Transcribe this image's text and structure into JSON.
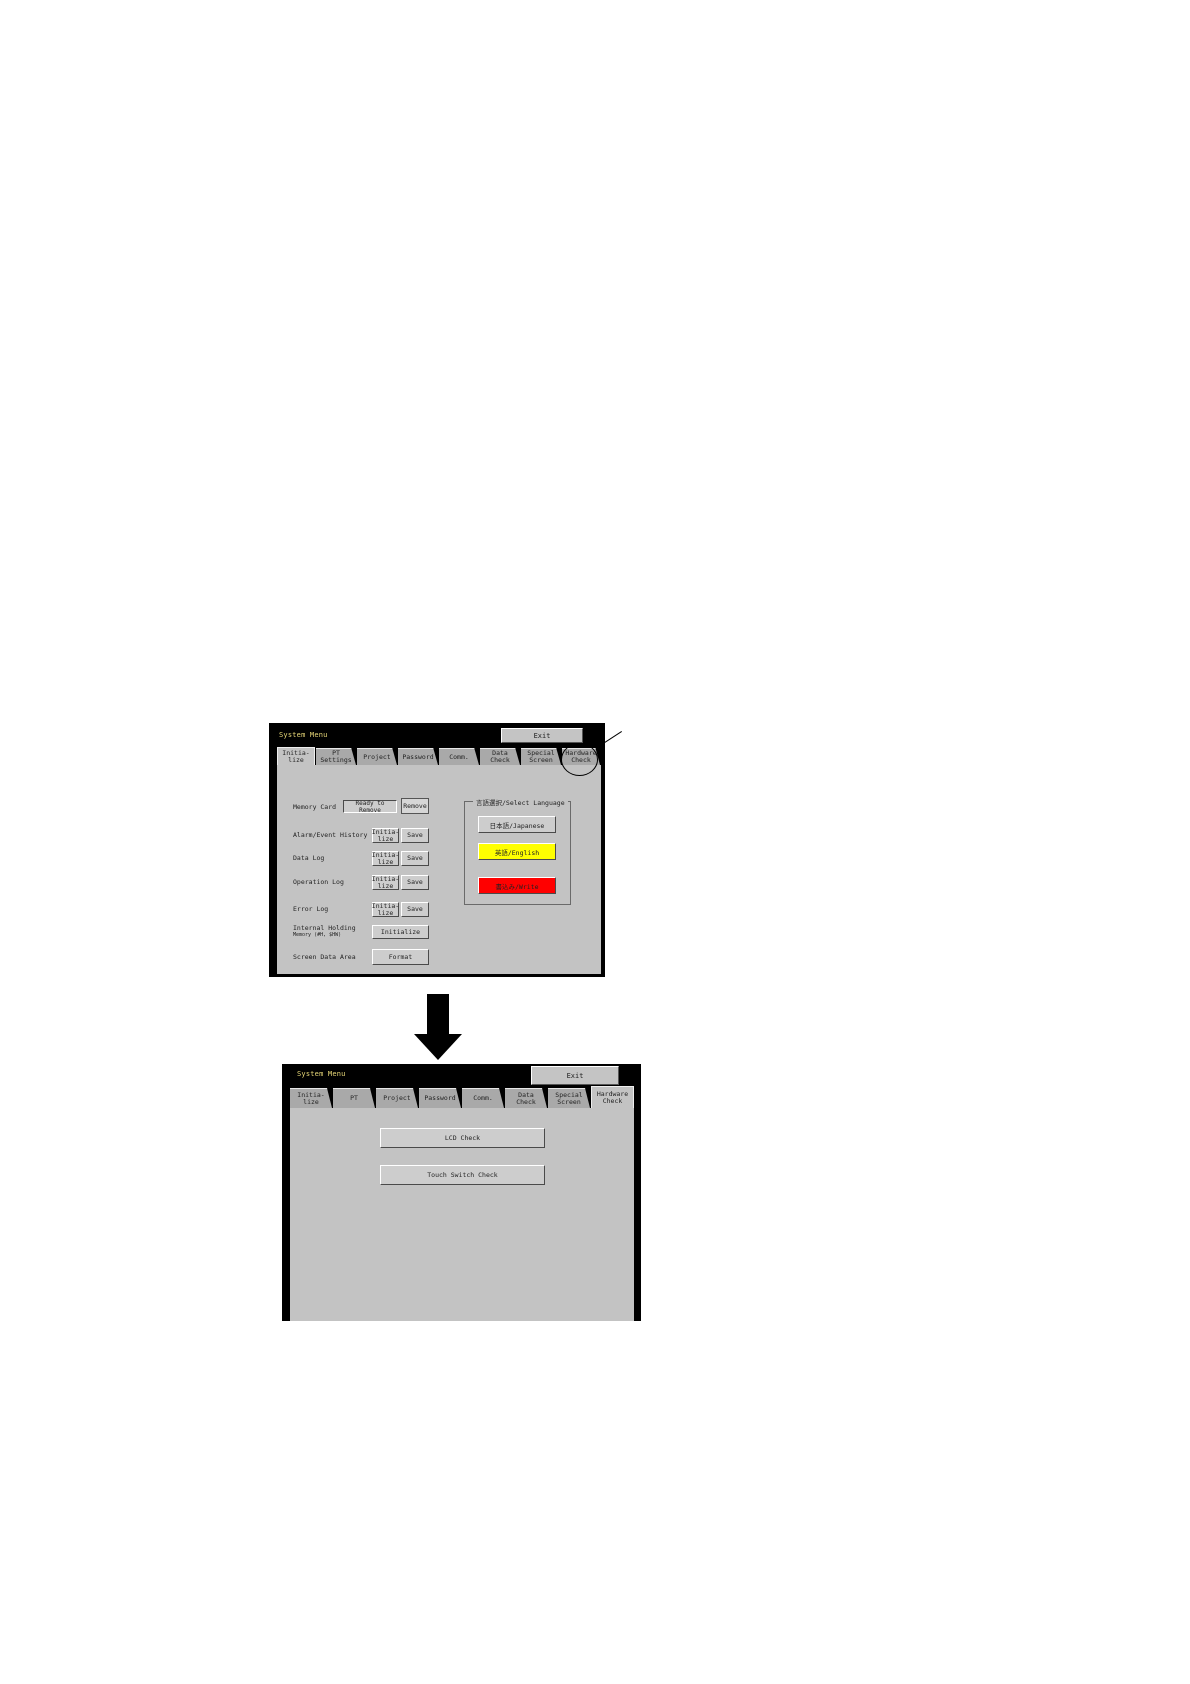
{
  "screen1": {
    "title": "System Menu",
    "exit_label": "Exit",
    "tabs": [
      "Initia-\nlize",
      "PT\nSettings",
      "Project",
      "Password",
      "Comm.",
      "Data\nCheck",
      "Special\nScreen",
      "Hardware\nCheck"
    ],
    "rows": {
      "memory_card": {
        "label": "Memory Card",
        "status": "Ready to Remove",
        "button": "Remove"
      },
      "alarm_history": {
        "label": "Alarm/Event History",
        "init": "Initia-\nlize",
        "save": "Save"
      },
      "data_log": {
        "label": "Data Log",
        "init": "Initia-\nlize",
        "save": "Save"
      },
      "operation_log": {
        "label": "Operation Log",
        "init": "Initia-\nlize",
        "save": "Save"
      },
      "error_log": {
        "label": "Error Log",
        "init": "Initia-\nlize",
        "save": "Save"
      },
      "internal_holding": {
        "label": "Internal Holding",
        "sublabel": "Memory (#H, $HW)",
        "button": "Initialize"
      },
      "screen_data": {
        "label": "Screen Data Area",
        "button": "Format"
      }
    },
    "language": {
      "title": "言語選択/Select Language",
      "japanese": "日本語/Japanese",
      "english": "英語/English",
      "write": "書込み/Write",
      "colors": {
        "japanese": "#cdcdcd",
        "english": "#ffff00",
        "write": "#ff0000"
      }
    }
  },
  "screen2": {
    "title": "System Menu",
    "exit_label": "Exit",
    "tabs": [
      "Initia-\nlize",
      "PT",
      "Project",
      "Password",
      "Comm.",
      "Data\nCheck",
      "Special\nScreen",
      "Hardware\nCheck"
    ],
    "buttons": {
      "lcd": "LCD Check",
      "touch": "Touch Switch Check"
    }
  }
}
